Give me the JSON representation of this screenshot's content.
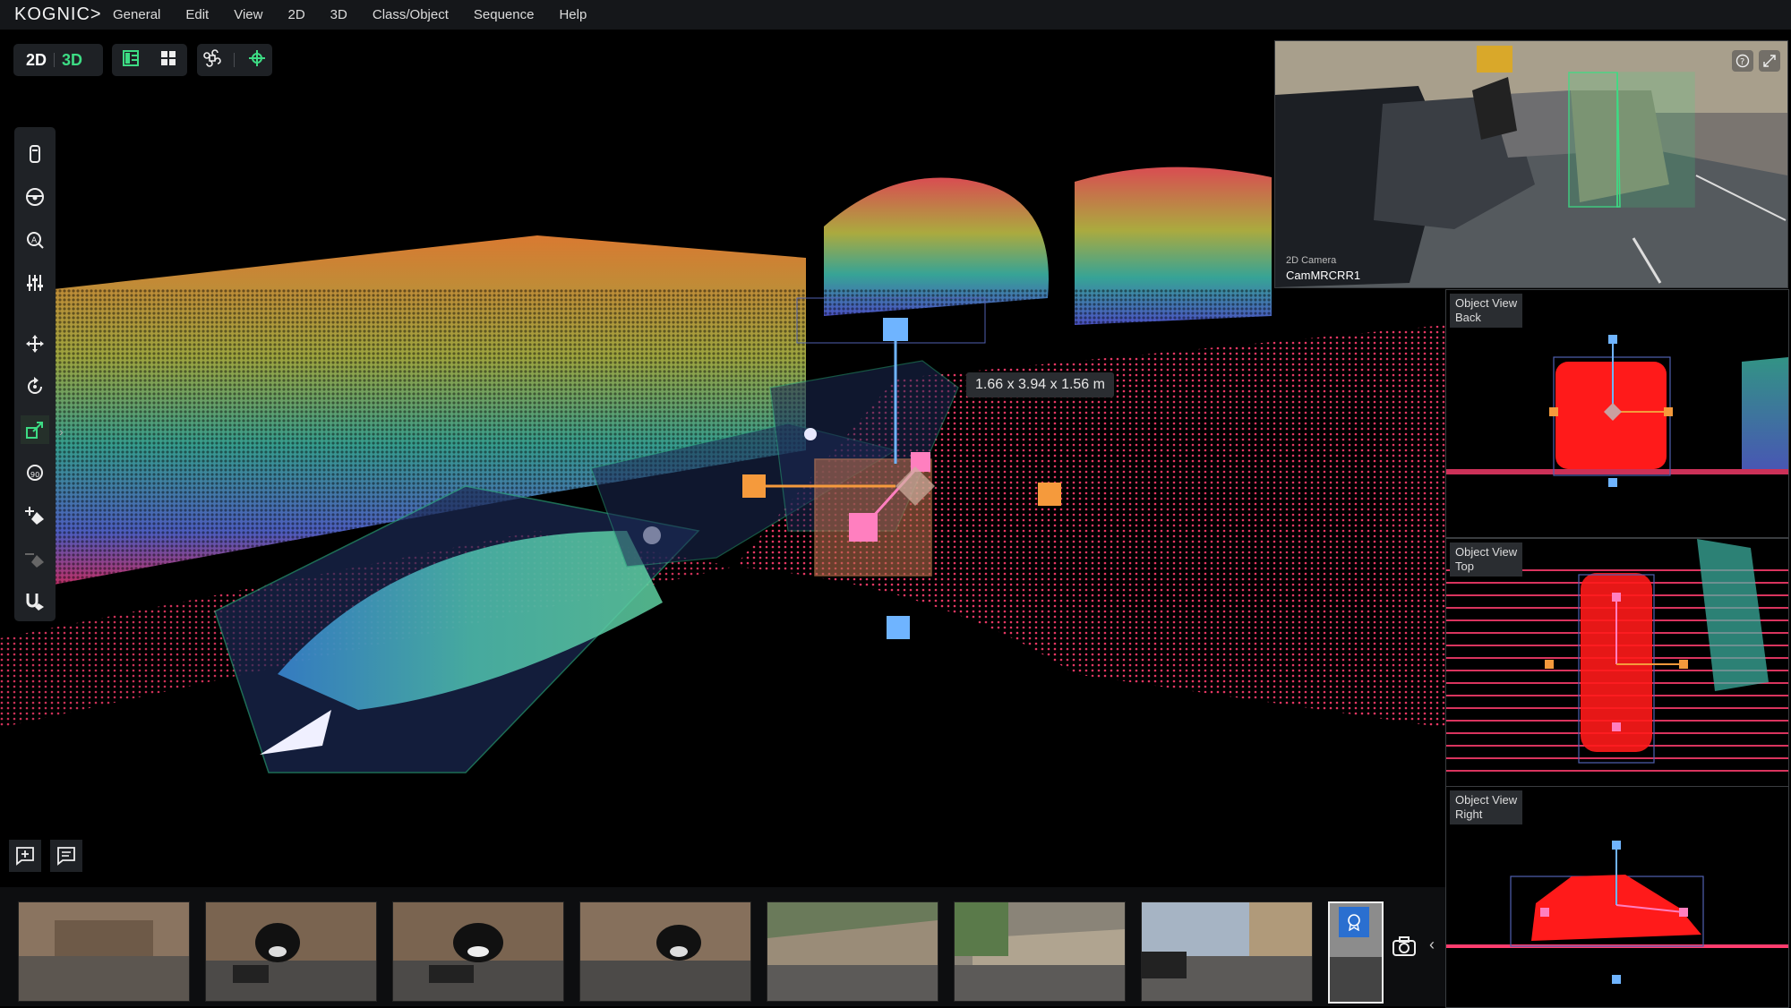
{
  "app": {
    "logo": "KOGNIC>"
  },
  "menu": [
    "General",
    "Edit",
    "View",
    "2D",
    "3D",
    "Class/Object",
    "Sequence",
    "Help"
  ],
  "toolbar": {
    "mode_2d": "2D",
    "mode_3d": "3D"
  },
  "viewport": {
    "dimensions_label": "1.66 x 3.94 x 1.56 m"
  },
  "camera": {
    "type_label": "2D Camera",
    "name": "CamMRCRR1"
  },
  "object_views": [
    {
      "title": "Object View",
      "view": "Back"
    },
    {
      "title": "Object View",
      "view": "Top"
    },
    {
      "title": "Object View",
      "view": "Right"
    }
  ],
  "tools": [
    "ego-vehicle-icon",
    "steering-wheel-icon",
    "zoom-icon",
    "sliders-icon",
    "move-icon",
    "rotate-icon",
    "resize-icon",
    "rotate-90-icon",
    "add-point-icon",
    "remove-point-icon",
    "magnet-icon"
  ],
  "colors": {
    "accent_green": "#3ddc84",
    "box_edge": "#2a9c7a",
    "handle_blue": "#6fb4ff",
    "handle_orange": "#f59a3c",
    "handle_pink": "#ff7fbf"
  }
}
